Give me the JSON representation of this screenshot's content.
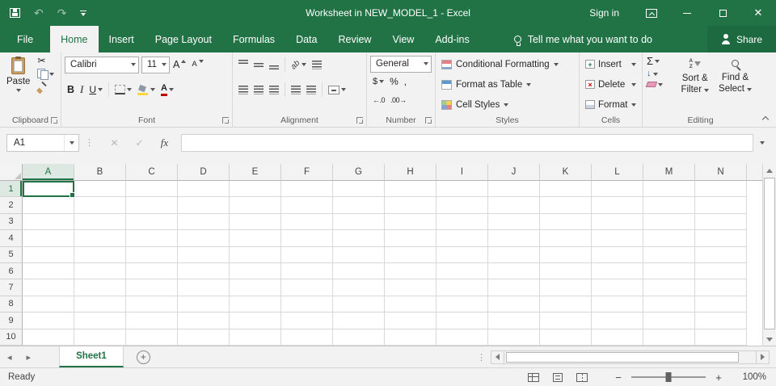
{
  "theme": {
    "accent_green": "#217346"
  },
  "titlebar": {
    "title": "Worksheet in NEW_MODEL_1 - Excel",
    "sign_in": "Sign in"
  },
  "ribbon_tabs": {
    "file": "File",
    "items": [
      "Home",
      "Insert",
      "Page Layout",
      "Formulas",
      "Data",
      "Review",
      "View",
      "Add-ins"
    ],
    "active": "Home",
    "tell_me": "Tell me what you want to do",
    "share": "Share"
  },
  "ribbon": {
    "clipboard": {
      "label": "Clipboard",
      "paste": "Paste"
    },
    "font": {
      "label": "Font",
      "family": "Calibri",
      "size": "11"
    },
    "alignment": {
      "label": "Alignment",
      "orientation": "ab"
    },
    "number": {
      "label": "Number",
      "format": "General"
    },
    "styles": {
      "label": "Styles",
      "conditional_formatting": "Conditional Formatting",
      "format_as_table": "Format as Table",
      "cell_styles": "Cell Styles"
    },
    "cells": {
      "label": "Cells",
      "insert": "Insert",
      "delete": "Delete",
      "format": "Format"
    },
    "editing": {
      "label": "Editing",
      "sort_line1": "Sort &",
      "sort_line2": "Filter",
      "find_line1": "Find &",
      "find_line2": "Select"
    }
  },
  "formula_bar": {
    "name_box": "A1",
    "formula": ""
  },
  "grid": {
    "columns": [
      "A",
      "B",
      "C",
      "D",
      "E",
      "F",
      "G",
      "H",
      "I",
      "J",
      "K",
      "L",
      "M",
      "N"
    ],
    "rows": [
      "1",
      "2",
      "3",
      "4",
      "5",
      "6",
      "7",
      "8",
      "9",
      "10"
    ],
    "selected_cell": "A1"
  },
  "sheet_bar": {
    "tabs": [
      {
        "label": "Sheet1",
        "active": true
      }
    ]
  },
  "status_bar": {
    "status": "Ready",
    "zoom": "100%"
  },
  "icons": {
    "undo": "↶",
    "redo": "↷",
    "close": "✕",
    "scissors": "✂",
    "bold": "B",
    "italic": "I",
    "underline": "U",
    "grow_font": "A",
    "shrink_font": "A",
    "font_color": "A",
    "sigma": "Σ",
    "fill_arrow": "↓",
    "fx": "fx",
    "cancel": "✕",
    "enter": "✓",
    "currency": "$",
    "percent": "%",
    "comma": ",",
    "increase_decimal": "←.0",
    "decrease_decimal": ".00→",
    "nav_left": "◂",
    "nav_right": "▸",
    "add_sheet": "+",
    "handle": "⋮",
    "zoom_minus": "−",
    "zoom_plus": "+"
  }
}
